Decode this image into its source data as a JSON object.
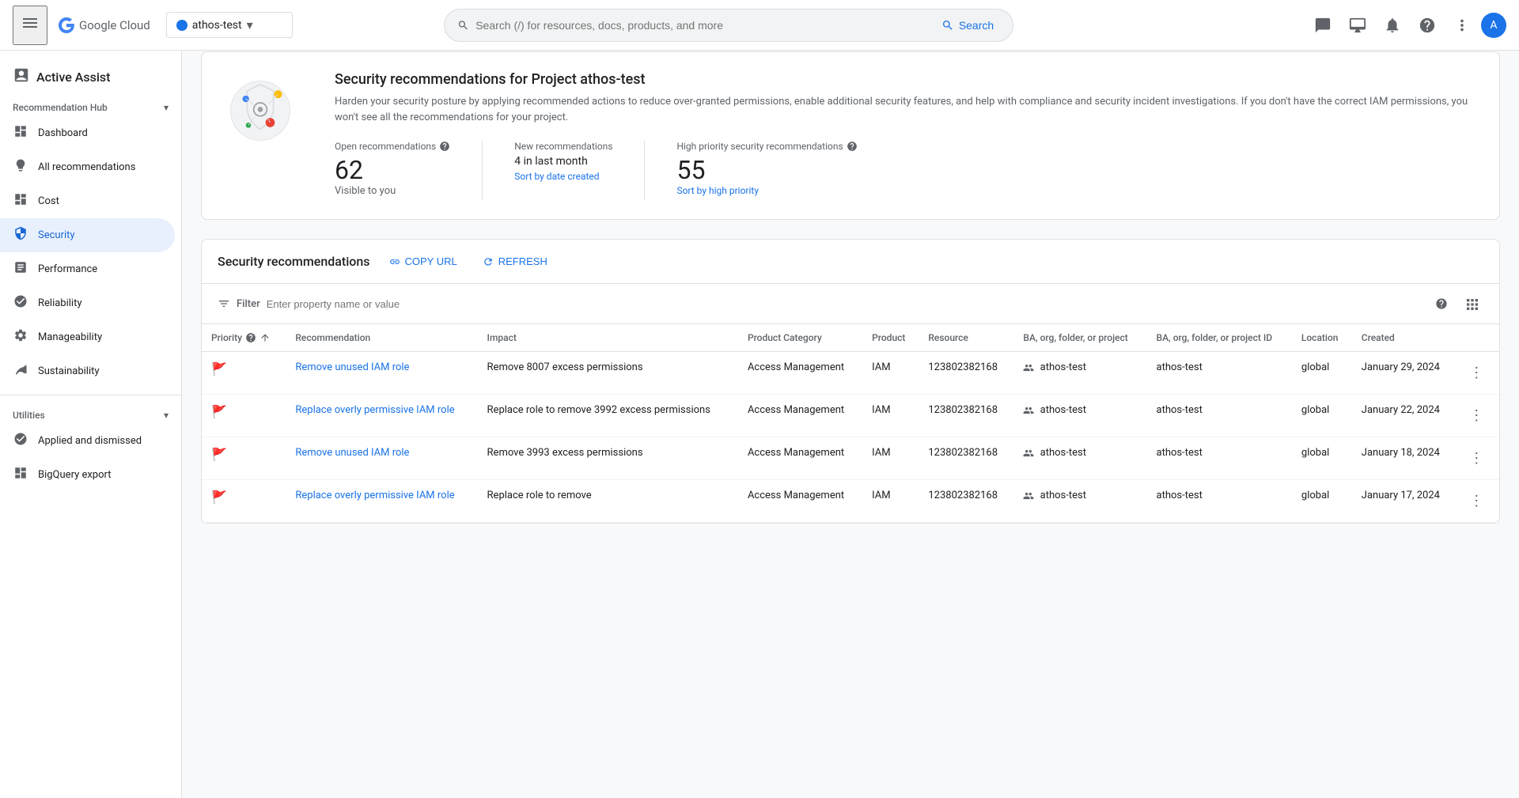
{
  "topnav": {
    "menu_icon": "☰",
    "logo_text": "Google Cloud",
    "project": {
      "name": "athos-test",
      "arrow": "▾"
    },
    "search_placeholder": "Search (/) for resources, docs, products, and more",
    "search_label": "Search",
    "icons": {
      "chat": "💬",
      "desktop": "🖥",
      "bell": "🔔",
      "help": "?",
      "more": "⋮",
      "avatar": "A"
    }
  },
  "sidebar": {
    "app_title": "Active Assist",
    "recommendation_hub_label": "Recommendation Hub",
    "items": [
      {
        "id": "dashboard",
        "label": "Dashboard",
        "icon": "⊞"
      },
      {
        "id": "all-recommendations",
        "label": "All recommendations",
        "icon": "💡"
      },
      {
        "id": "cost",
        "label": "Cost",
        "icon": "⊞"
      },
      {
        "id": "security",
        "label": "Security",
        "icon": "🔒",
        "active": true
      },
      {
        "id": "performance",
        "label": "Performance",
        "icon": "📈"
      },
      {
        "id": "reliability",
        "label": "Reliability",
        "icon": "◎"
      },
      {
        "id": "manageability",
        "label": "Manageability",
        "icon": "⚙"
      },
      {
        "id": "sustainability",
        "label": "Sustainability",
        "icon": "🌿"
      }
    ],
    "utilities_label": "Utilities",
    "utility_items": [
      {
        "id": "applied-dismissed",
        "label": "Applied and dismissed",
        "icon": "◎"
      },
      {
        "id": "bigquery-export",
        "label": "BigQuery export",
        "icon": "⊞"
      }
    ]
  },
  "page": {
    "title": "Security recommendations",
    "info_card": {
      "card_title": "Security recommendations for Project athos-test",
      "description": "Harden your security posture by applying recommended actions to reduce over-granted permissions, enable additional security features, and help with compliance and security incident investigations. If you don't have the correct IAM permissions, you won't see all the recommendations for your project.",
      "stats": [
        {
          "label": "Open recommendations",
          "has_help": true,
          "value": "62",
          "sub": "Visible to you",
          "link": null
        },
        {
          "label": "New recommendations",
          "has_help": false,
          "value": null,
          "sub": "4 in last month",
          "link": "Sort by date created"
        },
        {
          "label": "High priority security recommendations",
          "has_help": true,
          "value": "55",
          "sub": null,
          "link": "Sort by high priority"
        }
      ]
    },
    "table_section": {
      "title": "Security recommendations",
      "copy_url_label": "COPY URL",
      "refresh_label": "REFRESH",
      "filter_placeholder": "Enter property name or value",
      "filter_label": "Filter",
      "columns": [
        {
          "id": "priority",
          "label": "Priority",
          "has_help": true,
          "has_sort": true
        },
        {
          "id": "recommendation",
          "label": "Recommendation"
        },
        {
          "id": "impact",
          "label": "Impact"
        },
        {
          "id": "product_category",
          "label": "Product Category"
        },
        {
          "id": "product",
          "label": "Product"
        },
        {
          "id": "resource",
          "label": "Resource"
        },
        {
          "id": "ba_org_folder",
          "label": "BA, org, folder, or project"
        },
        {
          "id": "ba_org_folder_id",
          "label": "BA, org, folder, or project ID"
        },
        {
          "id": "location",
          "label": "Location"
        },
        {
          "id": "created",
          "label": "Created"
        },
        {
          "id": "actions",
          "label": ""
        }
      ],
      "rows": [
        {
          "priority": "high",
          "recommendation": "Remove unused IAM role",
          "recommendation_link": true,
          "impact": "Remove 8007 excess permissions",
          "product_category": "Access Management",
          "product": "IAM",
          "resource": "123802382168",
          "ba_org": "athos-test",
          "ba_org_id": "athos-test",
          "location": "global",
          "created": "January 29, 2024"
        },
        {
          "priority": "high",
          "recommendation": "Replace overly permissive IAM role",
          "recommendation_link": true,
          "impact": "Replace role to remove 3992 excess permissions",
          "product_category": "Access Management",
          "product": "IAM",
          "resource": "123802382168",
          "ba_org": "athos-test",
          "ba_org_id": "athos-test",
          "location": "global",
          "created": "January 22, 2024"
        },
        {
          "priority": "high",
          "recommendation": "Remove unused IAM role",
          "recommendation_link": true,
          "impact": "Remove 3993 excess permissions",
          "product_category": "Access Management",
          "product": "IAM",
          "resource": "123802382168",
          "ba_org": "athos-test",
          "ba_org_id": "athos-test",
          "location": "global",
          "created": "January 18, 2024"
        },
        {
          "priority": "high",
          "recommendation": "Replace overly permissive IAM role",
          "recommendation_link": true,
          "impact": "Replace role to remove",
          "product_category": "Access Management",
          "product": "IAM",
          "resource": "123802382168",
          "ba_org": "athos-test",
          "ba_org_id": "athos-test",
          "location": "global",
          "created": "January 17, 2024"
        }
      ]
    }
  }
}
